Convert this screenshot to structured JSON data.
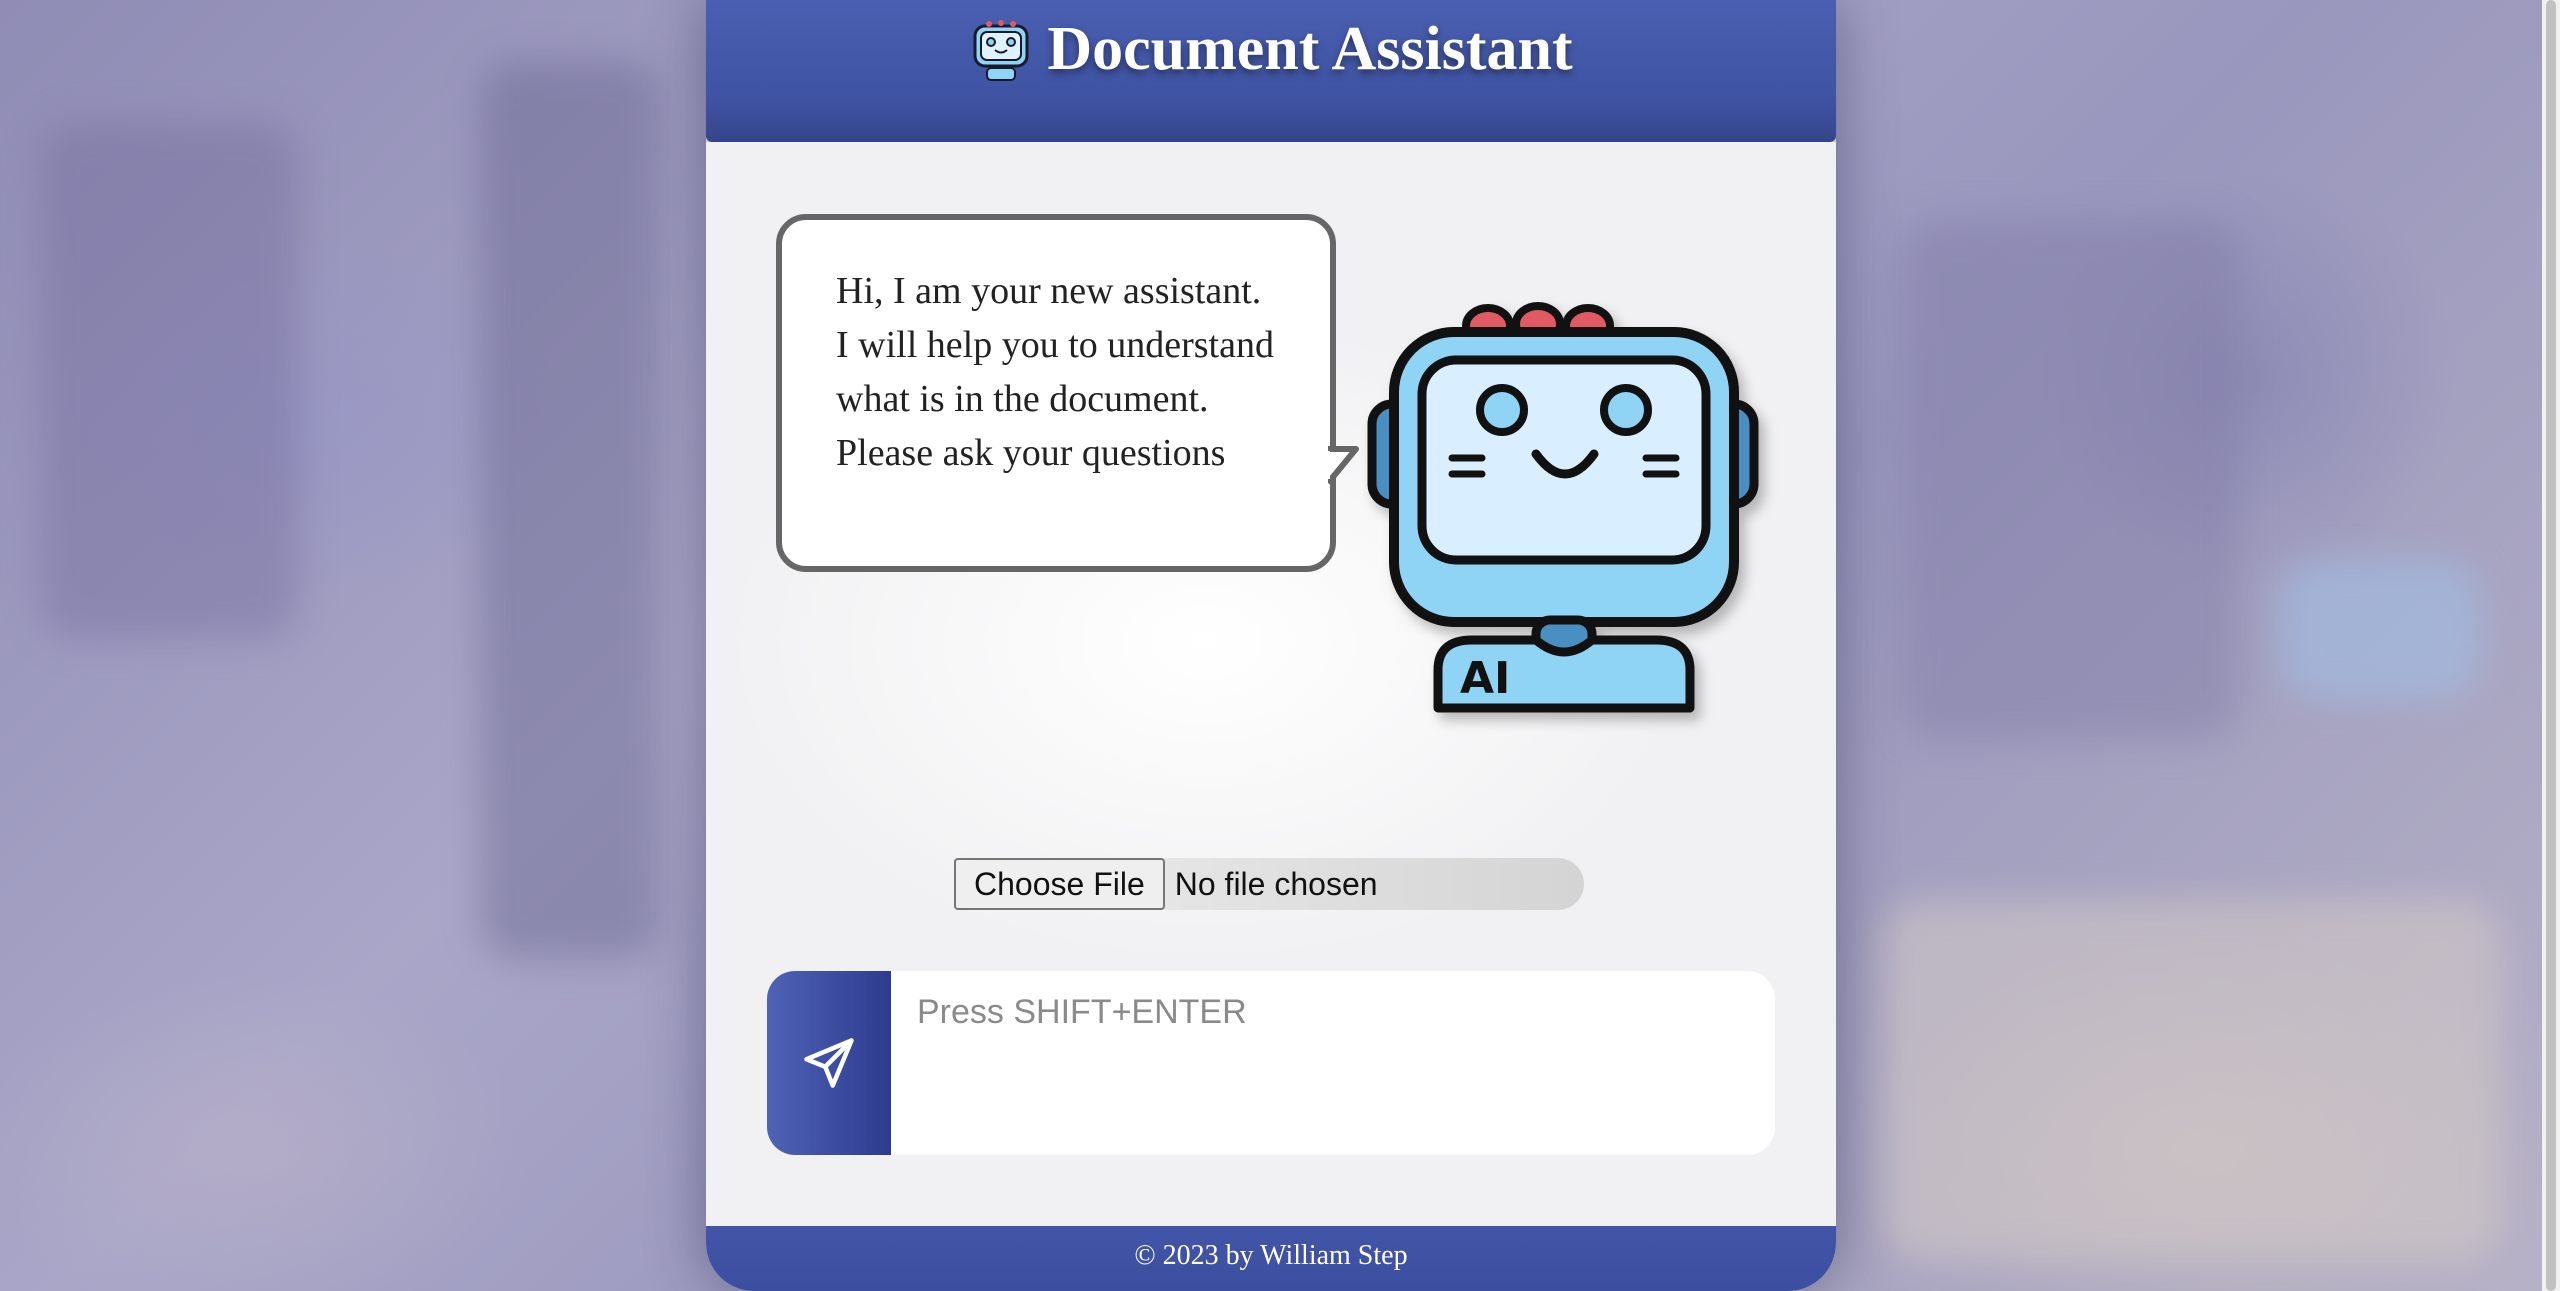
{
  "header": {
    "title": "Document Assistant",
    "logo_icon": "robot-icon"
  },
  "assistant": {
    "greeting": "Hi, I am your new assistant. I will help you to understand what is in the document. Please ask your questions",
    "mascot_icon": "robot-ai-icon",
    "mascot_badge": "AI"
  },
  "file_upload": {
    "button_label": "Choose File",
    "status": "No file chosen"
  },
  "chat": {
    "placeholder": "Press SHIFT+ENTER",
    "value": "",
    "send_icon": "send-icon"
  },
  "footer": {
    "text": "© 2023 by William Step"
  },
  "colors": {
    "header": "#4a5fb1",
    "footer": "#3f51a5",
    "send_button": "#2d3b8f",
    "robot_body": "#8fd3f5",
    "robot_accent": "#e05a64"
  }
}
